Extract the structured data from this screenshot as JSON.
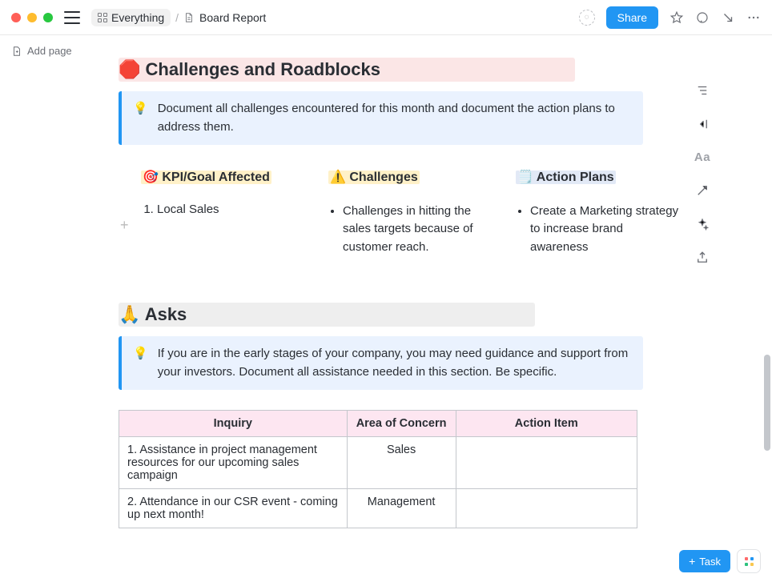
{
  "topbar": {
    "breadcrumb_root": "Everything",
    "breadcrumb_sep": "/",
    "breadcrumb_page": "Board Report",
    "share_label": "Share"
  },
  "sidebar": {
    "add_page_label": "Add page"
  },
  "sections": {
    "challenges": {
      "emoji": "🛑",
      "title": "Challenges and Roadblocks",
      "callout_icon": "💡",
      "callout_text": "Document all challenges encountered for this month and document the action plans to address them.",
      "columns": {
        "kpi": {
          "emoji": "🎯",
          "title": "KPI/Goal Affected",
          "items": [
            "Local Sales"
          ]
        },
        "chal": {
          "emoji": "⚠️",
          "title": "Challenges",
          "items": [
            "Challenges in hitting the sales targets because of customer reach."
          ]
        },
        "action": {
          "emoji": "🗒️",
          "title": "Action Plans",
          "items": [
            "Create a Marketing strategy to increase brand awareness"
          ]
        }
      }
    },
    "asks": {
      "emoji": "🙏",
      "title": "Asks",
      "callout_icon": "💡",
      "callout_text": "If you are in the early stages of your company, you may need guidance and support from your investors. Document all assistance needed in this section. Be specific.",
      "table": {
        "headers": [
          "Inquiry",
          "Area of Concern",
          "Action Item"
        ],
        "rows": [
          {
            "inquiry": "1. Assistance in project management resources for our upcoming sales campaign",
            "area": "Sales",
            "action": ""
          },
          {
            "inquiry": "2. Attendance in our CSR event - coming up next month!",
            "area": "Management",
            "action": ""
          }
        ]
      }
    }
  },
  "right_toolbar": {
    "text_style_label": "Aa"
  },
  "fab": {
    "task_label": "Task"
  }
}
